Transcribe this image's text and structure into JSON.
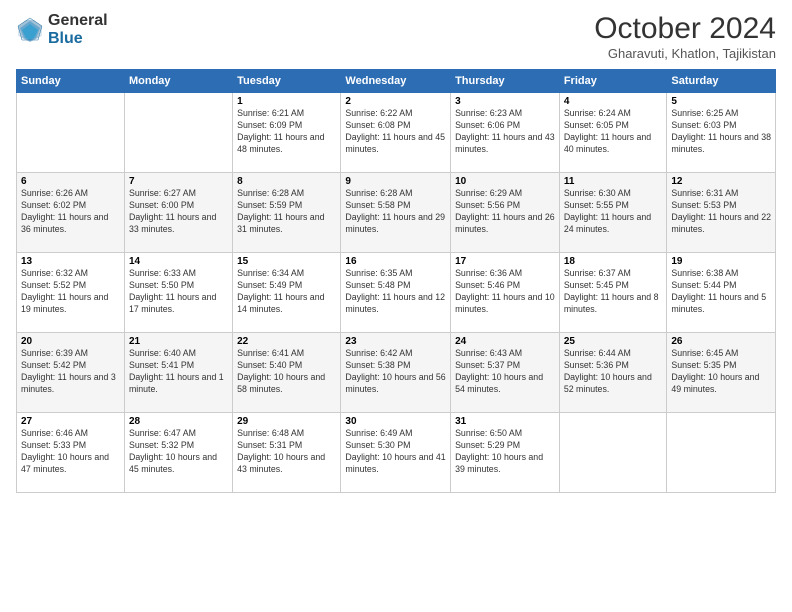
{
  "logo": {
    "general": "General",
    "blue": "Blue"
  },
  "title": "October 2024",
  "location": "Gharavuti, Khatlon, Tajikistan",
  "weekdays": [
    "Sunday",
    "Monday",
    "Tuesday",
    "Wednesday",
    "Thursday",
    "Friday",
    "Saturday"
  ],
  "weeks": [
    [
      {
        "day": "",
        "info": ""
      },
      {
        "day": "",
        "info": ""
      },
      {
        "day": "1",
        "info": "Sunrise: 6:21 AM\nSunset: 6:09 PM\nDaylight: 11 hours and 48 minutes."
      },
      {
        "day": "2",
        "info": "Sunrise: 6:22 AM\nSunset: 6:08 PM\nDaylight: 11 hours and 45 minutes."
      },
      {
        "day": "3",
        "info": "Sunrise: 6:23 AM\nSunset: 6:06 PM\nDaylight: 11 hours and 43 minutes."
      },
      {
        "day": "4",
        "info": "Sunrise: 6:24 AM\nSunset: 6:05 PM\nDaylight: 11 hours and 40 minutes."
      },
      {
        "day": "5",
        "info": "Sunrise: 6:25 AM\nSunset: 6:03 PM\nDaylight: 11 hours and 38 minutes."
      }
    ],
    [
      {
        "day": "6",
        "info": "Sunrise: 6:26 AM\nSunset: 6:02 PM\nDaylight: 11 hours and 36 minutes."
      },
      {
        "day": "7",
        "info": "Sunrise: 6:27 AM\nSunset: 6:00 PM\nDaylight: 11 hours and 33 minutes."
      },
      {
        "day": "8",
        "info": "Sunrise: 6:28 AM\nSunset: 5:59 PM\nDaylight: 11 hours and 31 minutes."
      },
      {
        "day": "9",
        "info": "Sunrise: 6:28 AM\nSunset: 5:58 PM\nDaylight: 11 hours and 29 minutes."
      },
      {
        "day": "10",
        "info": "Sunrise: 6:29 AM\nSunset: 5:56 PM\nDaylight: 11 hours and 26 minutes."
      },
      {
        "day": "11",
        "info": "Sunrise: 6:30 AM\nSunset: 5:55 PM\nDaylight: 11 hours and 24 minutes."
      },
      {
        "day": "12",
        "info": "Sunrise: 6:31 AM\nSunset: 5:53 PM\nDaylight: 11 hours and 22 minutes."
      }
    ],
    [
      {
        "day": "13",
        "info": "Sunrise: 6:32 AM\nSunset: 5:52 PM\nDaylight: 11 hours and 19 minutes."
      },
      {
        "day": "14",
        "info": "Sunrise: 6:33 AM\nSunset: 5:50 PM\nDaylight: 11 hours and 17 minutes."
      },
      {
        "day": "15",
        "info": "Sunrise: 6:34 AM\nSunset: 5:49 PM\nDaylight: 11 hours and 14 minutes."
      },
      {
        "day": "16",
        "info": "Sunrise: 6:35 AM\nSunset: 5:48 PM\nDaylight: 11 hours and 12 minutes."
      },
      {
        "day": "17",
        "info": "Sunrise: 6:36 AM\nSunset: 5:46 PM\nDaylight: 11 hours and 10 minutes."
      },
      {
        "day": "18",
        "info": "Sunrise: 6:37 AM\nSunset: 5:45 PM\nDaylight: 11 hours and 8 minutes."
      },
      {
        "day": "19",
        "info": "Sunrise: 6:38 AM\nSunset: 5:44 PM\nDaylight: 11 hours and 5 minutes."
      }
    ],
    [
      {
        "day": "20",
        "info": "Sunrise: 6:39 AM\nSunset: 5:42 PM\nDaylight: 11 hours and 3 minutes."
      },
      {
        "day": "21",
        "info": "Sunrise: 6:40 AM\nSunset: 5:41 PM\nDaylight: 11 hours and 1 minute."
      },
      {
        "day": "22",
        "info": "Sunrise: 6:41 AM\nSunset: 5:40 PM\nDaylight: 10 hours and 58 minutes."
      },
      {
        "day": "23",
        "info": "Sunrise: 6:42 AM\nSunset: 5:38 PM\nDaylight: 10 hours and 56 minutes."
      },
      {
        "day": "24",
        "info": "Sunrise: 6:43 AM\nSunset: 5:37 PM\nDaylight: 10 hours and 54 minutes."
      },
      {
        "day": "25",
        "info": "Sunrise: 6:44 AM\nSunset: 5:36 PM\nDaylight: 10 hours and 52 minutes."
      },
      {
        "day": "26",
        "info": "Sunrise: 6:45 AM\nSunset: 5:35 PM\nDaylight: 10 hours and 49 minutes."
      }
    ],
    [
      {
        "day": "27",
        "info": "Sunrise: 6:46 AM\nSunset: 5:33 PM\nDaylight: 10 hours and 47 minutes."
      },
      {
        "day": "28",
        "info": "Sunrise: 6:47 AM\nSunset: 5:32 PM\nDaylight: 10 hours and 45 minutes."
      },
      {
        "day": "29",
        "info": "Sunrise: 6:48 AM\nSunset: 5:31 PM\nDaylight: 10 hours and 43 minutes."
      },
      {
        "day": "30",
        "info": "Sunrise: 6:49 AM\nSunset: 5:30 PM\nDaylight: 10 hours and 41 minutes."
      },
      {
        "day": "31",
        "info": "Sunrise: 6:50 AM\nSunset: 5:29 PM\nDaylight: 10 hours and 39 minutes."
      },
      {
        "day": "",
        "info": ""
      },
      {
        "day": "",
        "info": ""
      }
    ]
  ]
}
